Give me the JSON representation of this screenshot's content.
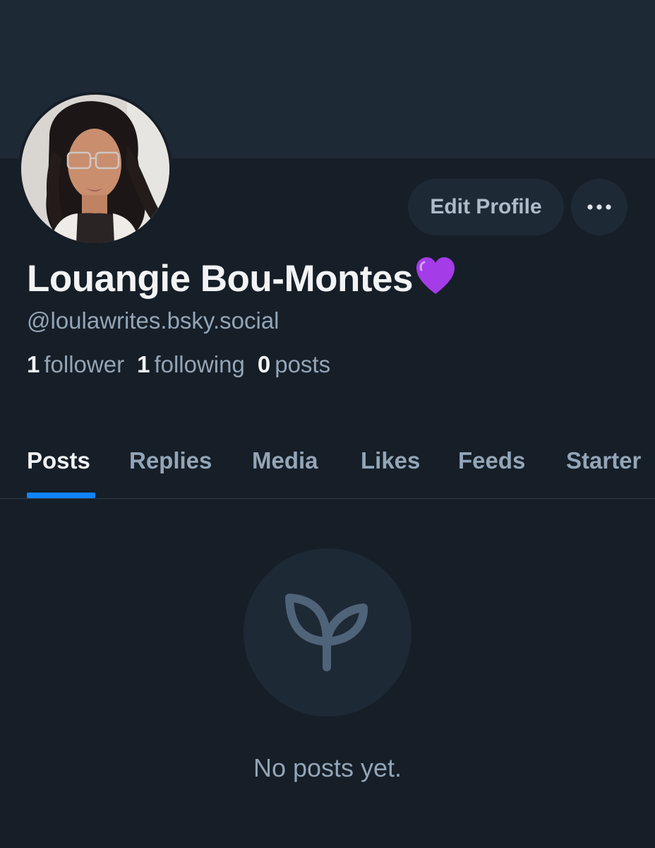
{
  "profile": {
    "display_name": "Louangie Bou-Montes",
    "name_emoji": "💜",
    "handle": "@loulawrites.bsky.social",
    "avatar_icon": "user-avatar-photo",
    "stats": {
      "followers_count": "1",
      "followers_label": "follower",
      "following_count": "1",
      "following_label": "following",
      "posts_count": "0",
      "posts_label": "posts"
    }
  },
  "actions": {
    "edit_profile_label": "Edit Profile",
    "more_icon": "ellipsis-icon"
  },
  "tabs": [
    {
      "label": "Posts",
      "active": true
    },
    {
      "label": "Replies",
      "active": false
    },
    {
      "label": "Media",
      "active": false
    },
    {
      "label": "Likes",
      "active": false
    },
    {
      "label": "Feeds",
      "active": false
    },
    {
      "label": "Starter",
      "active": false
    }
  ],
  "empty_state": {
    "icon": "sprout-icon",
    "message": "No posts yet."
  },
  "colors": {
    "background": "#161e27",
    "banner": "#1e2936",
    "accent": "#1083fe",
    "muted_text": "#93a5b7",
    "primary_text": "#f1f3f5"
  }
}
